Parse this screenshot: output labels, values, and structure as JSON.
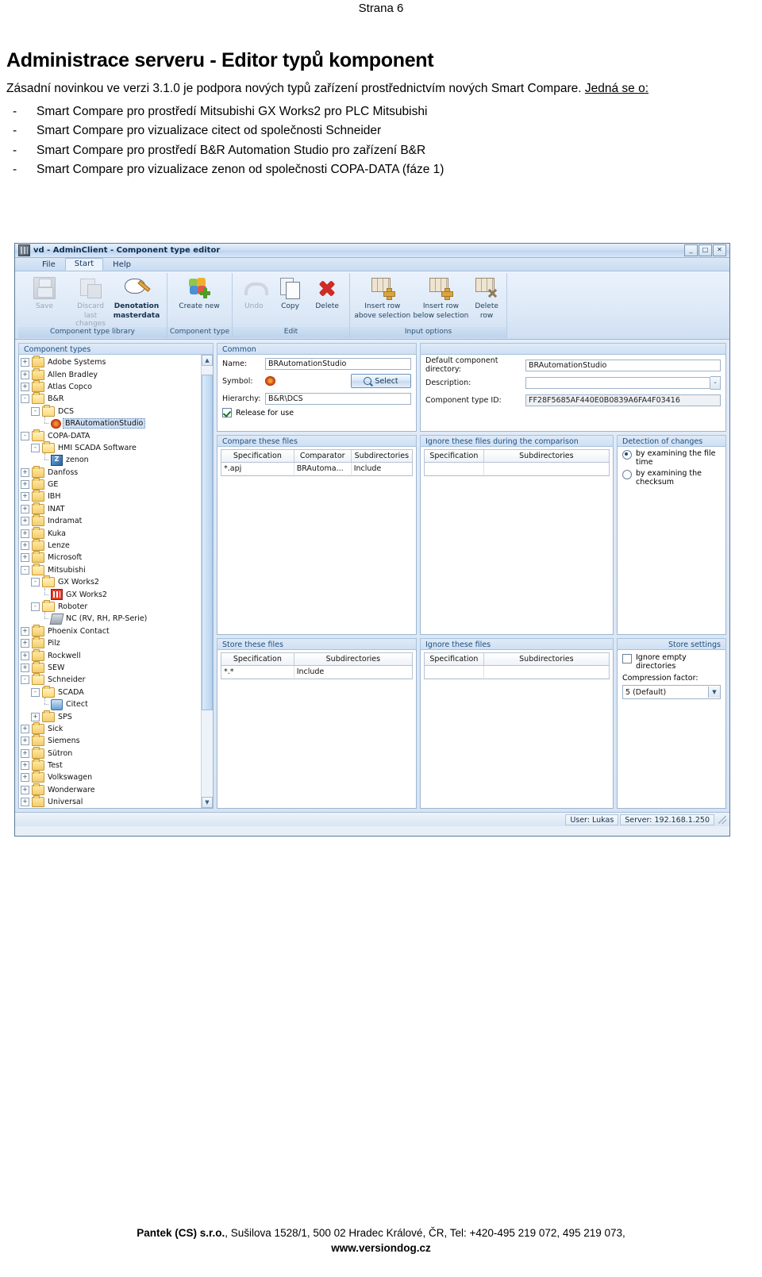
{
  "document": {
    "page_label": "Strana 6",
    "title": "Administrace serveru - Editor typů komponent",
    "paragraph_1": "Zásadní novinkou ve verzi 3.1.0 je podpora nových typů zařízení prostřednictvím nových Smart Compare.",
    "paragraph_1_underlined": "Jedná se o:",
    "dash": "-",
    "bullets": [
      "Smart Compare pro prostředí Mitsubishi GX Works2 pro PLC Mitsubishi",
      "Smart Compare pro vizualizace citect od společnosti Schneider",
      "Smart Compare pro prostředí B&R Automation Studio pro zařízení B&R",
      "Smart Compare pro vizualizace zenon od společnosti COPA-DATA (fáze 1)"
    ]
  },
  "app": {
    "titlebar": {
      "title": "vd - AdminClient - Component type editor",
      "minimize": "_",
      "maximize": "□",
      "close": "✕"
    },
    "ribbon_tabs": [
      {
        "label": "File",
        "active": false
      },
      {
        "label": "Start",
        "active": true
      },
      {
        "label": "Help",
        "active": false
      }
    ],
    "ribbon_groups": [
      {
        "label": "Component type library",
        "buttons": [
          {
            "line1": "Save",
            "line2": "",
            "icon": "save-icon",
            "disabled": true,
            "bold": false
          },
          {
            "line1": "Discard",
            "line2": "last changes",
            "icon": "discard-icon",
            "disabled": true,
            "bold": false
          },
          {
            "line1": "Denotation",
            "line2": "masterdata",
            "icon": "denotation-icon",
            "disabled": false,
            "bold": true
          }
        ]
      },
      {
        "label": "Component type",
        "buttons": [
          {
            "line1": "Create new",
            "line2": "",
            "icon": "create-new-icon",
            "disabled": false,
            "bold": false
          }
        ]
      },
      {
        "label": "Edit",
        "buttons": [
          {
            "line1": "Undo",
            "line2": "",
            "icon": "undo-icon",
            "disabled": true,
            "bold": false
          },
          {
            "line1": "Copy",
            "line2": "",
            "icon": "copy-icon",
            "disabled": false,
            "bold": false
          },
          {
            "line1": "Delete",
            "line2": "",
            "icon": "delete-icon",
            "disabled": false,
            "bold": false
          }
        ]
      },
      {
        "label": "Input options",
        "buttons": [
          {
            "line1": "Insert row",
            "line2": "above selection",
            "icon": "insert-row-above-icon",
            "disabled": false,
            "bold": false
          },
          {
            "line1": "Insert row",
            "line2": "below selection",
            "icon": "insert-row-below-icon",
            "disabled": false,
            "bold": false
          },
          {
            "line1": "Delete",
            "line2": "row",
            "icon": "delete-row-icon",
            "disabled": false,
            "bold": false
          }
        ]
      }
    ],
    "tree": {
      "header": "Component types",
      "nodes": [
        {
          "label": "Adobe Systems",
          "indent": 0,
          "expander": "+",
          "icon": "folder",
          "selected": false
        },
        {
          "label": "Allen Bradley",
          "indent": 0,
          "expander": "+",
          "icon": "folder",
          "selected": false
        },
        {
          "label": "Atlas Copco",
          "indent": 0,
          "expander": "+",
          "icon": "folder",
          "selected": false
        },
        {
          "label": "B&R",
          "indent": 0,
          "expander": "-",
          "icon": "folder-open",
          "selected": false
        },
        {
          "label": "DCS",
          "indent": 1,
          "expander": "-",
          "icon": "folder-open",
          "selected": false
        },
        {
          "label": "BRAutomationStudio",
          "indent": 2,
          "expander": "",
          "icon": "br-icon",
          "selected": true
        },
        {
          "label": "COPA-DATA",
          "indent": 0,
          "expander": "-",
          "icon": "folder-open",
          "selected": false
        },
        {
          "label": "HMI SCADA Software",
          "indent": 1,
          "expander": "-",
          "icon": "folder-open",
          "selected": false
        },
        {
          "label": "zenon",
          "indent": 2,
          "expander": "",
          "icon": "zenon-icon",
          "selected": false
        },
        {
          "label": "Danfoss",
          "indent": 0,
          "expander": "+",
          "icon": "folder",
          "selected": false
        },
        {
          "label": "GE",
          "indent": 0,
          "expander": "+",
          "icon": "folder",
          "selected": false
        },
        {
          "label": "IBH",
          "indent": 0,
          "expander": "+",
          "icon": "folder",
          "selected": false
        },
        {
          "label": "INAT",
          "indent": 0,
          "expander": "+",
          "icon": "folder",
          "selected": false
        },
        {
          "label": "Indramat",
          "indent": 0,
          "expander": "+",
          "icon": "folder",
          "selected": false
        },
        {
          "label": "Kuka",
          "indent": 0,
          "expander": "+",
          "icon": "folder",
          "selected": false
        },
        {
          "label": "Lenze",
          "indent": 0,
          "expander": "+",
          "icon": "folder",
          "selected": false
        },
        {
          "label": "Microsoft",
          "indent": 0,
          "expander": "+",
          "icon": "folder",
          "selected": false
        },
        {
          "label": "Mitsubishi",
          "indent": 0,
          "expander": "-",
          "icon": "folder-open",
          "selected": false
        },
        {
          "label": "GX Works2",
          "indent": 1,
          "expander": "-",
          "icon": "folder-open",
          "selected": false
        },
        {
          "label": "GX Works2",
          "indent": 2,
          "expander": "",
          "icon": "gx-icon",
          "selected": false
        },
        {
          "label": "Roboter",
          "indent": 1,
          "expander": "-",
          "icon": "folder-open",
          "selected": false
        },
        {
          "label": "NC (RV, RH, RP-Serie)",
          "indent": 2,
          "expander": "",
          "icon": "nc-icon",
          "selected": false
        },
        {
          "label": "Phoenix Contact",
          "indent": 0,
          "expander": "+",
          "icon": "folder",
          "selected": false
        },
        {
          "label": "Pilz",
          "indent": 0,
          "expander": "+",
          "icon": "folder",
          "selected": false
        },
        {
          "label": "Rockwell",
          "indent": 0,
          "expander": "+",
          "icon": "folder",
          "selected": false
        },
        {
          "label": "SEW",
          "indent": 0,
          "expander": "+",
          "icon": "folder",
          "selected": false
        },
        {
          "label": "Schneider",
          "indent": 0,
          "expander": "-",
          "icon": "folder-open",
          "selected": false
        },
        {
          "label": "SCADA",
          "indent": 1,
          "expander": "-",
          "icon": "folder-open",
          "selected": false
        },
        {
          "label": "Citect",
          "indent": 2,
          "expander": "",
          "icon": "citect-icon",
          "selected": false
        },
        {
          "label": "SPS",
          "indent": 1,
          "expander": "+",
          "icon": "folder",
          "selected": false
        },
        {
          "label": "Sick",
          "indent": 0,
          "expander": "+",
          "icon": "folder",
          "selected": false
        },
        {
          "label": "Siemens",
          "indent": 0,
          "expander": "+",
          "icon": "folder",
          "selected": false
        },
        {
          "label": "Sütron",
          "indent": 0,
          "expander": "+",
          "icon": "folder",
          "selected": false
        },
        {
          "label": "Test",
          "indent": 0,
          "expander": "+",
          "icon": "folder",
          "selected": false
        },
        {
          "label": "Volkswagen",
          "indent": 0,
          "expander": "+",
          "icon": "folder",
          "selected": false
        },
        {
          "label": "Wonderware",
          "indent": 0,
          "expander": "+",
          "icon": "folder",
          "selected": false
        },
        {
          "label": "Universal",
          "indent": 0,
          "expander": "+",
          "icon": "folder",
          "selected": false
        }
      ]
    },
    "common": {
      "header": "Common",
      "name_label": "Name:",
      "name_value": "BRAutomationStudio",
      "symbol_label": "Symbol:",
      "select_button": "Select",
      "hierarchy_label": "Hierarchy:",
      "hierarchy_value": "B&R\\DCS",
      "release_label": "Release for use",
      "release_checked": true,
      "default_dir_label": "Default component directory:",
      "default_dir_value": "BRAutomationStudio",
      "description_label": "Description:",
      "description_value": "",
      "type_id_label": "Component type ID:",
      "type_id_value": "FF28F5685AF440E0B0839A6FA4F03416"
    },
    "compare_files": {
      "header": "Compare these files",
      "columns": [
        "Specification",
        "Comparator",
        "Subdirectories"
      ],
      "rows": [
        [
          "*.apj",
          "BRAutoma...",
          "Include"
        ]
      ]
    },
    "ignore_compare": {
      "header": "Ignore these files during the comparison",
      "columns": [
        "Specification",
        "Subdirectories"
      ],
      "rows": []
    },
    "detection": {
      "header": "Detection of changes",
      "options": [
        {
          "label": "by examining the file time",
          "selected": true
        },
        {
          "label": "by examining the checksum",
          "selected": false
        }
      ]
    },
    "store_files": {
      "header": "Store these files",
      "columns": [
        "Specification",
        "Subdirectories"
      ],
      "rows": [
        [
          "*.*",
          "Include"
        ]
      ]
    },
    "ignore_store": {
      "header": "Ignore these files",
      "columns": [
        "Specification",
        "Subdirectories"
      ],
      "rows": []
    },
    "store_settings": {
      "header": "Store settings",
      "ignore_empty_label": "Ignore empty directories",
      "ignore_empty_checked": false,
      "compression_label": "Compression factor:",
      "compression_value": "5 (Default)"
    },
    "statusbar": {
      "user": "User: Lukas",
      "server": "Server: 192.168.1.250"
    }
  },
  "footer": {
    "company": "Pantek (CS) s.r.o.",
    "address": ", Sušilova 1528/1, 500 02 Hradec Králové, ČR, Tel: +420-495 219 072, 495 219 073,",
    "website": "www.versiondog.cz"
  }
}
